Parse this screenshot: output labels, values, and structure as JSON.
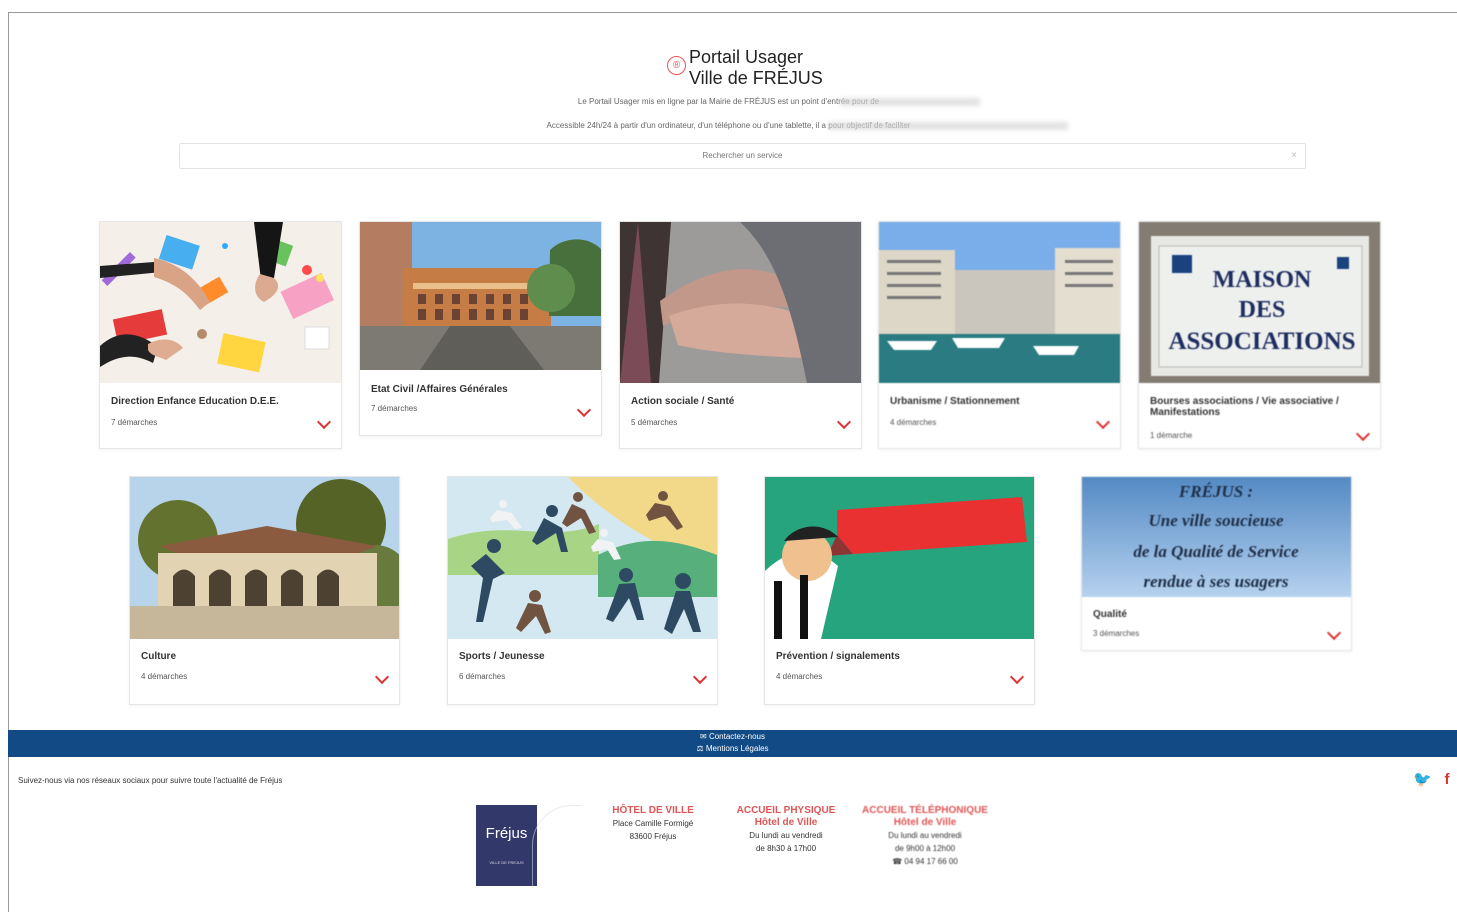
{
  "header": {
    "title_line1": "Portail Usager",
    "title_line2": "Ville de FRÉJUS",
    "logo_symbol": "®",
    "intro1": "Le Portail Usager mis en ligne par la Mairie de FRÉJUS est un point d'entrée pour de",
    "intro2": "Accessible 24h/24 à partir d'un ordinateur, d'un téléphone ou d'une tablette, il a pour objectif de faciliter",
    "search_placeholder": "Rechercher un service",
    "search_clear": "×"
  },
  "cards": [
    {
      "title": "Direction Enfance Education D.E.E.",
      "count": "7 démarches"
    },
    {
      "title": "Etat Civil /Affaires Générales",
      "count": "7 démarches"
    },
    {
      "title": "Action sociale / Santé",
      "count": "5 démarches"
    },
    {
      "title": "Urbanisme / Stationnement",
      "count": "4 démarches"
    },
    {
      "title": "Bourses associations / Vie associative / Manifestations",
      "count": "1 démarche"
    },
    {
      "title": "Culture",
      "count": "4 démarches"
    },
    {
      "title": "Sports / Jeunesse",
      "count": "6 démarches"
    },
    {
      "title": "Prévention / signalements",
      "count": "4 démarches"
    },
    {
      "title": "Qualité",
      "count": "3 démarches"
    }
  ],
  "quality_image": {
    "line1": "FRÉJUS :",
    "line2": "Une ville soucieuse",
    "line3": "de la Qualité de Service",
    "line4": "rendue à ses usagers"
  },
  "association_sign": {
    "line1": "MAISON",
    "line2": "DES",
    "line3": "ASSOCIATIONS"
  },
  "footer": {
    "contact": "✉ Contactez-nous",
    "legal": "⚖ Mentions Légales",
    "social_text": "Suivez-nous via nos réseaux sociaux pour suivre toute l'actualité de Fréjus",
    "logo_text": "Fréjus",
    "logo_subtext": "VILLE DE FREJUS",
    "col1_title": "HÔTEL DE VILLE",
    "col1_line1": "Place Camille Formigé",
    "col1_line2": "83600 Fréjus",
    "col2_title1": "ACCUEIL PHYSIQUE",
    "col2_title2": "Hôtel de Ville",
    "col2_line1": "Du lundi au vendredi",
    "col2_line2": "de 8h30 à 17h00",
    "col3_title1": "ACCUEIL TÉLÉPHONIQUE",
    "col3_title2": "Hôtel de Ville",
    "col3_line1": "Du lundi au vendredi",
    "col3_line2": "de 9h00 à 12h00",
    "col3_phone": "☎ 04 94 17 66 00"
  },
  "social_icons": [
    "twitter-icon",
    "facebook-icon"
  ],
  "colors": {
    "accent": "#d33333",
    "footer": "#114a84",
    "logo_bg": "#33386a"
  }
}
